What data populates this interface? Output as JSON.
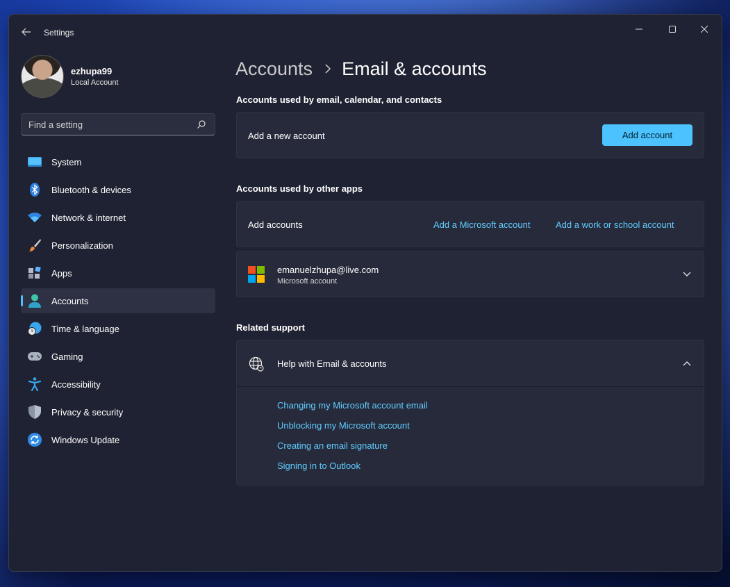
{
  "window": {
    "title": "Settings"
  },
  "profile": {
    "name": "ezhupa99",
    "account_type": "Local Account"
  },
  "search": {
    "placeholder": "Find a setting"
  },
  "nav": {
    "items": [
      {
        "label": "System",
        "icon": "monitor-icon"
      },
      {
        "label": "Bluetooth & devices",
        "icon": "bluetooth-icon"
      },
      {
        "label": "Network & internet",
        "icon": "wifi-icon"
      },
      {
        "label": "Personalization",
        "icon": "brush-icon"
      },
      {
        "label": "Apps",
        "icon": "apps-icon"
      },
      {
        "label": "Accounts",
        "icon": "person-icon",
        "active": true
      },
      {
        "label": "Time & language",
        "icon": "clock-globe-icon"
      },
      {
        "label": "Gaming",
        "icon": "gamepad-icon"
      },
      {
        "label": "Accessibility",
        "icon": "accessibility-icon"
      },
      {
        "label": "Privacy & security",
        "icon": "shield-icon"
      },
      {
        "label": "Windows Update",
        "icon": "refresh-icon"
      }
    ]
  },
  "breadcrumb": {
    "parent": "Accounts",
    "current": "Email & accounts"
  },
  "sections": {
    "email_calendar": {
      "title": "Accounts used by email, calendar, and contacts",
      "row_label": "Add a new account",
      "button_label": "Add account"
    },
    "other_apps": {
      "title": "Accounts used by other apps",
      "row_label": "Add accounts",
      "link_microsoft": "Add a Microsoft account",
      "link_work": "Add a work or school account",
      "account": {
        "email": "emanuelzhupa@live.com",
        "type": "Microsoft account"
      }
    },
    "support": {
      "title": "Related support",
      "help_title": "Help with Email & accounts",
      "links": [
        "Changing my Microsoft account email",
        "Unblocking my Microsoft account",
        "Creating an email signature",
        "Signing in to Outlook"
      ]
    }
  },
  "colors": {
    "accent": "#4cc2ff",
    "link": "#60cdff",
    "card": "#272a3a",
    "window": "#1f2232"
  }
}
